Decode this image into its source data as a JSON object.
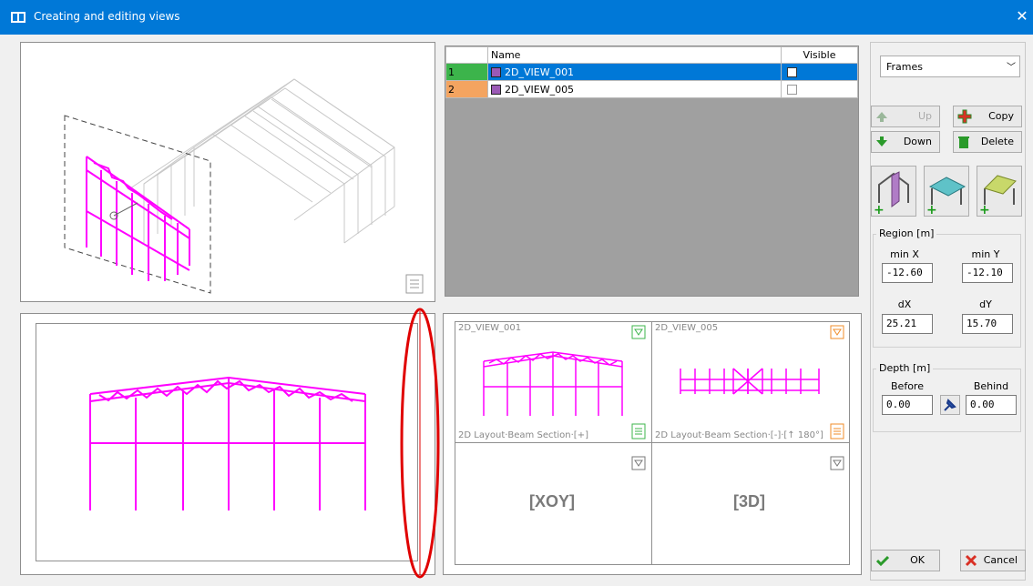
{
  "window": {
    "title": "Creating and editing views",
    "close_glyph": "✕"
  },
  "table": {
    "col_name": "Name",
    "col_visible": "Visible",
    "rows": [
      {
        "num": "1",
        "name": "2D_VIEW_001",
        "color": "#3cb44b",
        "selected": true,
        "visible": false
      },
      {
        "num": "2",
        "name": "2D_VIEW_005",
        "color": "#f4a460",
        "selected": false,
        "visible": false
      }
    ]
  },
  "dropdown": {
    "value": "Frames"
  },
  "buttons": {
    "up": "Up",
    "copy": "Copy",
    "down": "Down",
    "delete": "Delete",
    "ok": "OK",
    "cancel": "Cancel"
  },
  "region": {
    "title": "Region [m]",
    "min_x_label": "min X",
    "min_x": "-12.60",
    "min_y_label": "min Y",
    "min_y": "-12.10",
    "dx_label": "dX",
    "dx": "25.21",
    "dy_label": "dY",
    "dy": "15.70"
  },
  "depth": {
    "title": "Depth [m]",
    "before_label": "Before",
    "before": "0.00",
    "behind_label": "Behind",
    "behind": "0.00"
  },
  "views": {
    "v1_name": "2D_VIEW_001",
    "v1_caption": "2D Layout·Beam Section·[+]",
    "v2_name": "2D_VIEW_005",
    "v2_caption": "2D Layout·Beam Section·[-]·[↑ 180°]",
    "v3_label": "[XOY]",
    "v4_label": "[3D]"
  },
  "colors": {
    "accent": "#0078d7",
    "magenta": "#ff00ff",
    "annotation": "#e00000",
    "green": "#3cb44b",
    "orange": "#f08c28"
  }
}
